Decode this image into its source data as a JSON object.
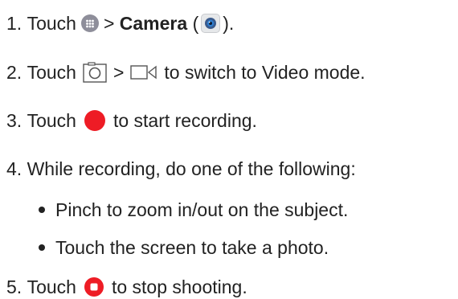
{
  "steps": [
    {
      "number": "1.",
      "pre": "Touch",
      "sep": ">",
      "bold": "Camera",
      "open_paren": "(",
      "close_paren": ")."
    },
    {
      "number": "2.",
      "pre": "Touch",
      "sep": ">",
      "post": "to switch to Video mode."
    },
    {
      "number": "3.",
      "pre": "Touch",
      "post": "to start recording."
    },
    {
      "number": "4.",
      "text": "While recording, do one of the following:",
      "bullets": [
        "Pinch to zoom in/out on the subject.",
        "Touch the screen to take a photo."
      ]
    },
    {
      "number": "5.",
      "pre": "Touch",
      "post": "to stop shooting."
    }
  ],
  "icons": {
    "apps": "apps-icon",
    "camera_app": "camera-app-icon",
    "camera_mode": "camera-mode-icon",
    "video_mode": "video-mode-icon",
    "record": "record-icon",
    "stop": "stop-icon"
  },
  "colors": {
    "text": "#222222",
    "record_red": "#ee1c25",
    "apps_gray": "#8e8e9a"
  }
}
